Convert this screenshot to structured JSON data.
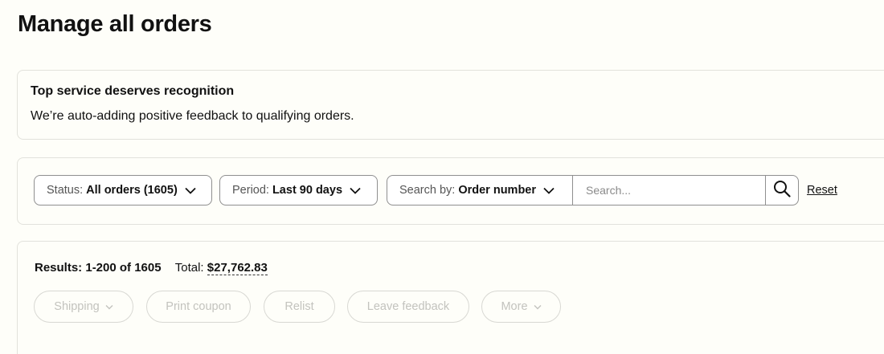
{
  "page": {
    "title": "Manage all orders"
  },
  "notice": {
    "title": "Top service deserves recognition",
    "body": "We’re auto-adding positive feedback to qualifying orders."
  },
  "filters": {
    "status": {
      "label": "Status:",
      "value": "All orders (1605)"
    },
    "period": {
      "label": "Period:",
      "value": "Last 90 days"
    },
    "search_by": {
      "label": "Search by:",
      "value": "Order number"
    },
    "search_placeholder": "Search...",
    "reset_label": "Reset"
  },
  "results": {
    "count_text": "Results: 1-200 of 1605",
    "total_label": "Total:",
    "total_value": "$27,762.83"
  },
  "actions": [
    {
      "label": "Shipping",
      "has_chevron": true,
      "enabled": false
    },
    {
      "label": "Print coupon",
      "has_chevron": false,
      "enabled": false
    },
    {
      "label": "Relist",
      "has_chevron": false,
      "enabled": false
    },
    {
      "label": "Leave feedback",
      "has_chevron": false,
      "enabled": false
    },
    {
      "label": "More",
      "has_chevron": true,
      "enabled": false
    }
  ],
  "colors": {
    "background": "#fefef9",
    "border": "#8f8f8f",
    "disabled_text": "#c3c3be"
  }
}
